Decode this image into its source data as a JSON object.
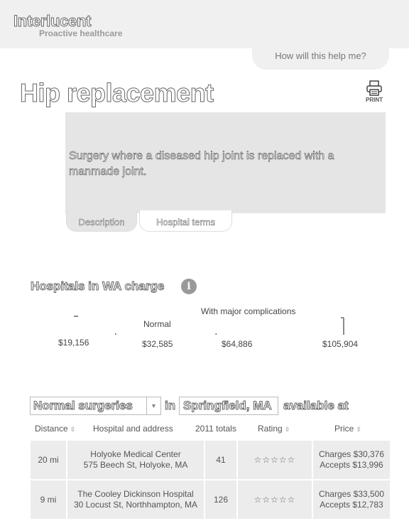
{
  "header": {
    "brand": "Interlucent",
    "tagline": "Proactive healthcare",
    "help_label": "How will this help me?"
  },
  "procedure": {
    "title": "Hip replacement",
    "print_label": "PRINT",
    "description": "Surgery where a diseased hip joint is replaced with a manmade joint."
  },
  "tabs": [
    {
      "label": "Description"
    },
    {
      "label": "Hospital terms"
    }
  ],
  "charges": {
    "heading": "Hospitals in WA charge",
    "info_symbol": "i"
  },
  "chart_data": {
    "type": "box",
    "title": "",
    "values": [
      19156,
      32585,
      64886,
      105904
    ],
    "value_labels": [
      "$19,156",
      "$32,585",
      "$64,886",
      "$105,904"
    ],
    "annotations": [
      "Normal",
      "With major complications"
    ],
    "colors": {
      "line": "#666666"
    }
  },
  "filter": {
    "surgery_type": "Normal surgeries",
    "word_in": "in",
    "location": "Springfield, MA",
    "word_available": "available at"
  },
  "table": {
    "headers": [
      "Distance",
      "Hospital and address",
      "2011 totals",
      "Rating",
      "Price"
    ],
    "rows": [
      {
        "distance": "20 mi",
        "name": "Holyoke Medical Center",
        "address": "575 Beech St, Holyoke, MA",
        "total": "41",
        "rating": "☆☆☆☆☆",
        "charges": "Charges $30,376",
        "accepts": "Accepts $13,996"
      },
      {
        "distance": "9 mi",
        "name": "The Cooley Dickinson Hospital",
        "address": "30 Locust St, Northhampton, MA",
        "total": "126",
        "rating": "☆☆☆☆☆",
        "charges": "Charges $33,500",
        "accepts": "Accepts $12,783"
      }
    ]
  }
}
